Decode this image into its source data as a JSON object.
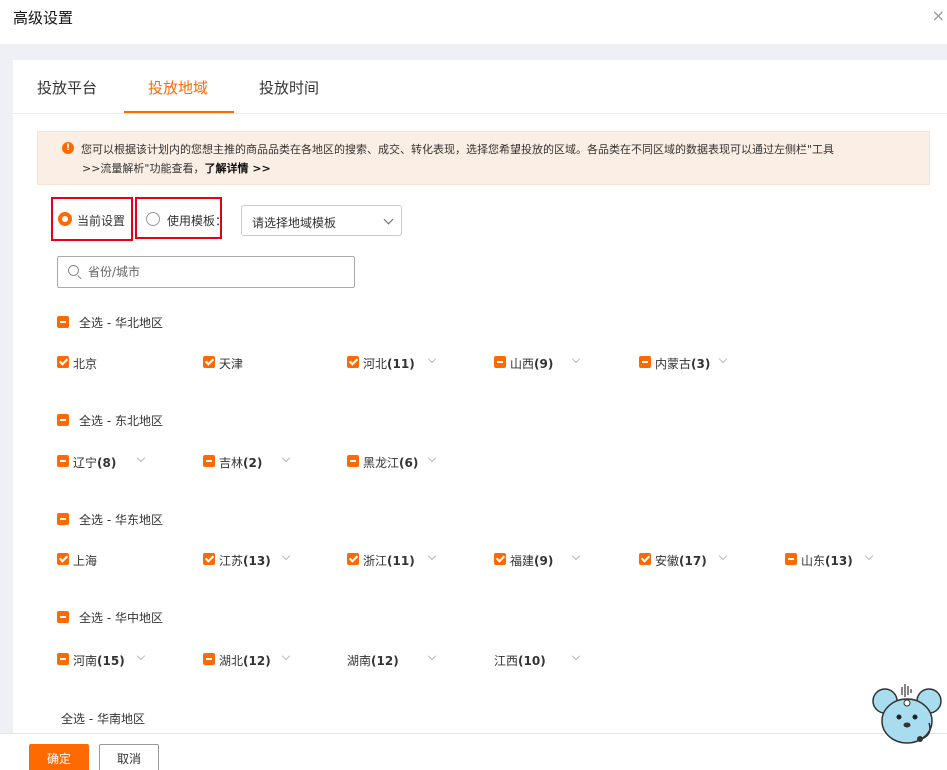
{
  "dialog": {
    "title": "高级设置",
    "close_glyph": "×"
  },
  "tabs": [
    {
      "label": "投放平台"
    },
    {
      "label": "投放地域"
    },
    {
      "label": "投放时间"
    }
  ],
  "notice": {
    "line1": "您可以根据该计划内的您想主推的商品品类在各地区的搜索、成交、转化表现，选择您希望投放的区域。各品类在不同区域的数据表现可以通过左侧栏\"工具",
    "line2_prefix": ">>流量解析\"功能查看，",
    "link": "了解详情 >>"
  },
  "mode": {
    "current_label": "当前设置",
    "template_label": "使用模板：",
    "template_select_value": "请选择地域模板"
  },
  "search": {
    "placeholder": "省份/城市"
  },
  "regions": [
    {
      "label": "全选 - 华北地区",
      "items": [
        {
          "name": "北京",
          "count": "",
          "state": "checked"
        },
        {
          "name": "天津",
          "count": "",
          "state": "checked"
        },
        {
          "name": "河北",
          "count": "(11)",
          "state": "checked"
        },
        {
          "name": "山西",
          "count": "(9)",
          "state": "partial"
        },
        {
          "name": "内蒙古",
          "count": "(3)",
          "state": "partial"
        }
      ]
    },
    {
      "label": "全选 - 东北地区",
      "items": [
        {
          "name": "辽宁",
          "count": "(8)",
          "state": "partial"
        },
        {
          "name": "吉林",
          "count": "(2)",
          "state": "partial"
        },
        {
          "name": "黑龙江",
          "count": "(6)",
          "state": "partial"
        }
      ]
    },
    {
      "label": "全选 - 华东地区",
      "items": [
        {
          "name": "上海",
          "count": "",
          "state": "checked"
        },
        {
          "name": "江苏",
          "count": "(13)",
          "state": "checked"
        },
        {
          "name": "浙江",
          "count": "(11)",
          "state": "checked"
        },
        {
          "name": "福建",
          "count": "(9)",
          "state": "checked"
        },
        {
          "name": "安徽",
          "count": "(17)",
          "state": "checked"
        },
        {
          "name": "山东",
          "count": "(13)",
          "state": "partial"
        }
      ]
    },
    {
      "label": "全选 - 华中地区",
      "items": [
        {
          "name": "河南",
          "count": "(15)",
          "state": "partial"
        },
        {
          "name": "湖北",
          "count": "(12)",
          "state": "partial"
        },
        {
          "name": "湖南",
          "count": "(12)",
          "state": "none"
        },
        {
          "name": "江西",
          "count": "(10)",
          "state": "none"
        }
      ]
    },
    {
      "label": "全选 - 华南地区",
      "items": []
    }
  ],
  "footer": {
    "ok_label": "确定",
    "cancel_label": "取消"
  },
  "colors": {
    "accent": "#ff6a00",
    "highlight_box": "#e60012",
    "notice_bg": "#fbeee4"
  }
}
